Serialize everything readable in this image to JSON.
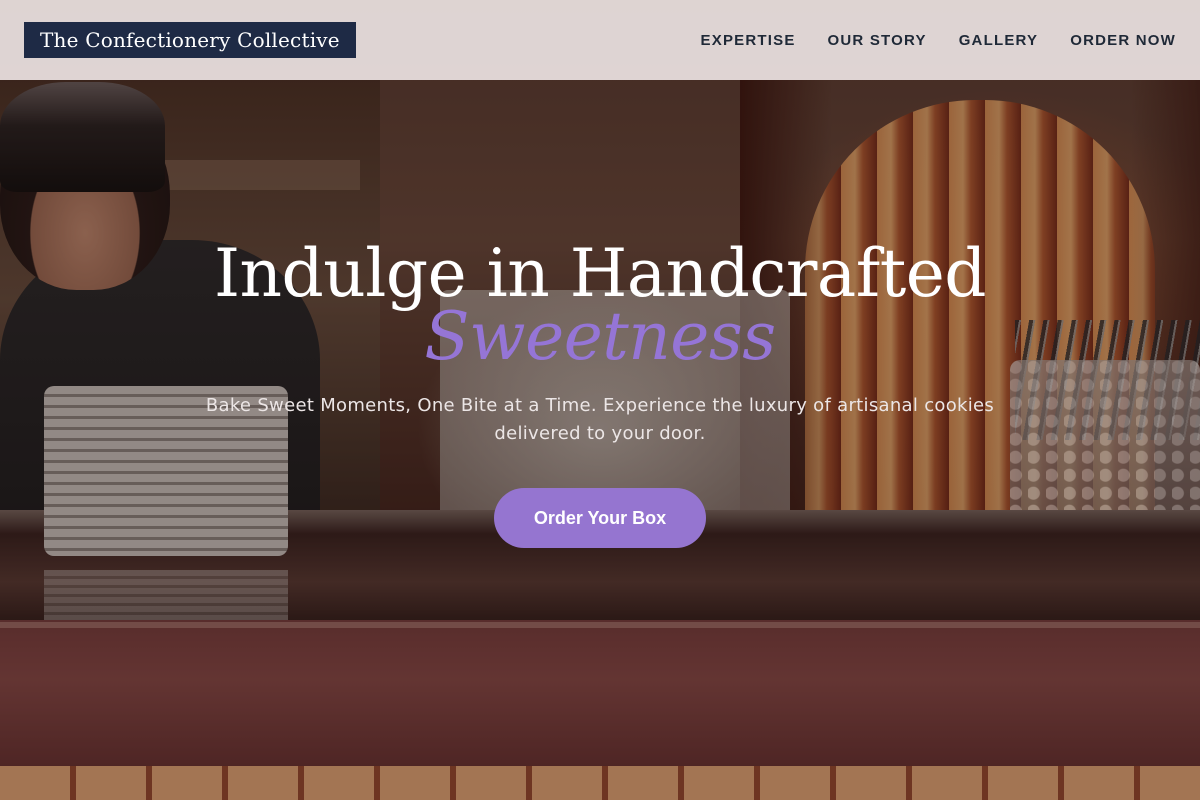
{
  "header": {
    "logo_text": "The Confectionery Collective",
    "nav": [
      {
        "label": "EXPERTISE"
      },
      {
        "label": "OUR STORY"
      },
      {
        "label": "GALLERY"
      },
      {
        "label": "ORDER NOW"
      }
    ]
  },
  "hero": {
    "title_line1": "Indulge in Handcrafted",
    "title_accent": "Sweetness",
    "subtitle": "Bake Sweet Moments, One Bite at a Time. Experience the luxury of artisanal cookies delivered to your door.",
    "cta_label": "Order Your Box",
    "background_image": "bakery counter with plates, cash register and glassware"
  },
  "colors": {
    "logo_bg": "#1e2a45",
    "accent": "#9575d6",
    "button_bg": "#9575d0",
    "header_bg": "#f8f0f0"
  }
}
